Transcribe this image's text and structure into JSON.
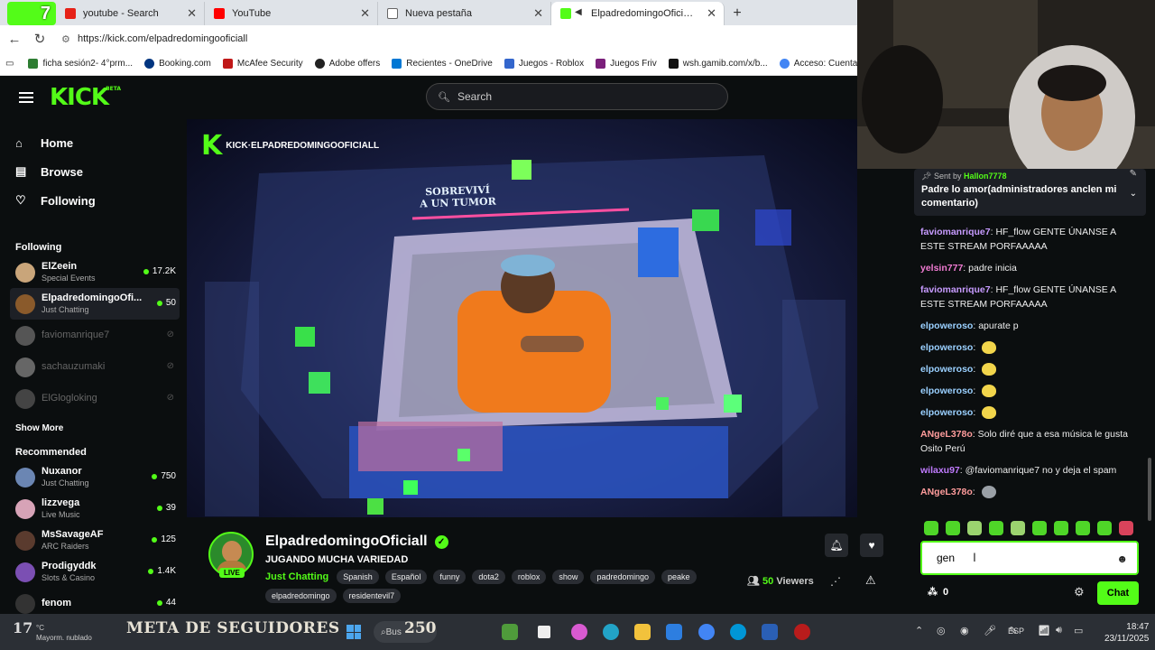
{
  "browser": {
    "tabs": [
      {
        "label": "youtube - Search",
        "fav": "#e62117"
      },
      {
        "label": "YouTube",
        "fav": "#ff0000"
      },
      {
        "label": "Nueva pestaña",
        "fav": "#666666"
      },
      {
        "label": "ElpadredomingoOficiall Stre",
        "fav": "#53fc18"
      }
    ],
    "overlay_number": "7",
    "url": "https://kick.com/elpadredomingooficiall",
    "bookmarks": [
      {
        "label": "ficha sesión2- 4°prm...",
        "color": "#2e7d32"
      },
      {
        "label": "Booking.com",
        "color": "#003580"
      },
      {
        "label": "McAfee Security",
        "color": "#c01818"
      },
      {
        "label": "Adobe offers",
        "color": "#222222"
      },
      {
        "label": "Recientes - OneDrive",
        "color": "#0078d4"
      },
      {
        "label": "Juegos - Roblox",
        "color": "#3366cc"
      },
      {
        "label": "Juegos Friv",
        "color": "#7a1f7a"
      },
      {
        "label": "wsh.gamib.com/x/b...",
        "color": "#111111"
      },
      {
        "label": "Acceso: Cuentas de",
        "color": "#4285f4"
      }
    ]
  },
  "kick": {
    "logo": "KICK",
    "logo_sup": "BETA",
    "search_placeholder": "Search",
    "nav": [
      {
        "label": "Home",
        "icon": "home-icon",
        "glyph": "⌂"
      },
      {
        "label": "Browse",
        "icon": "browse-icon",
        "glyph": "▤"
      },
      {
        "label": "Following",
        "icon": "heart-icon",
        "glyph": "♡"
      }
    ],
    "following_title": "Following",
    "following": [
      {
        "name": "ElZeein",
        "sub": "Special Events",
        "viewers": "17.2K",
        "color": "#c9a57a",
        "live": true
      },
      {
        "name": "ElpadredomingoOfi...",
        "sub": "Just Chatting",
        "viewers": "50",
        "color": "#8a5a2b",
        "live": true,
        "active": true
      },
      {
        "name": "faviomanrique7",
        "sub": "",
        "viewers": "",
        "color": "#555",
        "live": false
      },
      {
        "name": "sachauzumaki",
        "sub": "",
        "viewers": "",
        "color": "#666",
        "live": false
      },
      {
        "name": "ElGlogloking",
        "sub": "",
        "viewers": "",
        "color": "#444",
        "live": false
      }
    ],
    "show_more": "Show More",
    "recommended_title": "Recommended",
    "recommended": [
      {
        "name": "Nuxanor",
        "sub": "Just Chatting",
        "viewers": "750",
        "color": "#6b86b3"
      },
      {
        "name": "lizzvega",
        "sub": "Live Music",
        "viewers": "39",
        "color": "#d7a3b7"
      },
      {
        "name": "MsSavageAF",
        "sub": "ARC Raiders",
        "viewers": "125",
        "color": "#5a3b2e"
      },
      {
        "name": "Prodigyddk",
        "sub": "Slots & Casino",
        "viewers": "1.4K",
        "color": "#7b4fb3"
      },
      {
        "name": "fenom",
        "sub": "",
        "viewers": "44",
        "color": "#333"
      }
    ]
  },
  "video": {
    "watermark": "KICK·ELPADREDOMINGOOFICIALL",
    "overlay_title_1": "SOBREVIVÍ",
    "overlay_title_2": "A UN TUMOR"
  },
  "stream": {
    "name": "ElpadredomingoOficiall",
    "live_badge": "LIVE",
    "title": "JUGANDO MUCHA VARIEDAD",
    "category": "Just Chatting",
    "tags": [
      "Spanish",
      "Español",
      "funny",
      "dota2",
      "roblox",
      "show",
      "padredomingo",
      "peake",
      "elpadredomingo",
      "residentevil7"
    ],
    "viewers_count": "50",
    "viewers_label": "Viewers"
  },
  "chat": {
    "pinned_by_label": "Sent by",
    "pinned_by": "Hallon7778",
    "pinned_msg": "Padre lo amor(administradores anclen mi comentario)",
    "messages": [
      {
        "user": "faviomanrique7",
        "text": "HF_flow GENTE ÚNANSE A ESTE STREAM PORFAAAAA",
        "color": "#c79bff",
        "emote": ""
      },
      {
        "user": "yelsin777",
        "text": "padre inicia",
        "color": "#f07bd2",
        "emote": ""
      },
      {
        "user": "faviomanrique7",
        "text": "HF_flow GENTE ÚNANSE A ESTE STREAM PORFAAAAA",
        "color": "#c79bff",
        "emote": ""
      },
      {
        "user": "elpoweroso",
        "text": "apurate p",
        "color": "#9ad0ff",
        "emote": ""
      },
      {
        "user": "elpoweroso",
        "text": "",
        "color": "#9ad0ff",
        "emote": "yellow"
      },
      {
        "user": "elpoweroso",
        "text": "",
        "color": "#9ad0ff",
        "emote": "yellow"
      },
      {
        "user": "elpoweroso",
        "text": "",
        "color": "#9ad0ff",
        "emote": "yellow"
      },
      {
        "user": "elpoweroso",
        "text": "",
        "color": "#9ad0ff",
        "emote": "yellow"
      },
      {
        "user": "ANgeL378o",
        "text": "Solo diré que a esa música le gusta Osito Perú",
        "color": "#ff9c9c",
        "emote": ""
      },
      {
        "user": "wilaxu97",
        "text": "@faviomanrique7 no y deja el spam",
        "color": "#c07bff",
        "emote": ""
      },
      {
        "user": "ANgeL378o",
        "text": "",
        "color": "#ff9c9c",
        "emote": "gray"
      }
    ],
    "input_value": "gen",
    "points": "0",
    "send_label": "Chat"
  },
  "taskbar": {
    "temp": "17",
    "deg": "°C",
    "weather_desc": "Mayorm. nublado",
    "meta_text": "META DE SEGUIDORES",
    "meta_num": "250",
    "search_label": "Bus",
    "lang": "ESP",
    "time": "18:47",
    "date": "23/11/2025"
  },
  "colors": {
    "kick_green": "#53fc18",
    "bg": "#0b0e0f"
  }
}
